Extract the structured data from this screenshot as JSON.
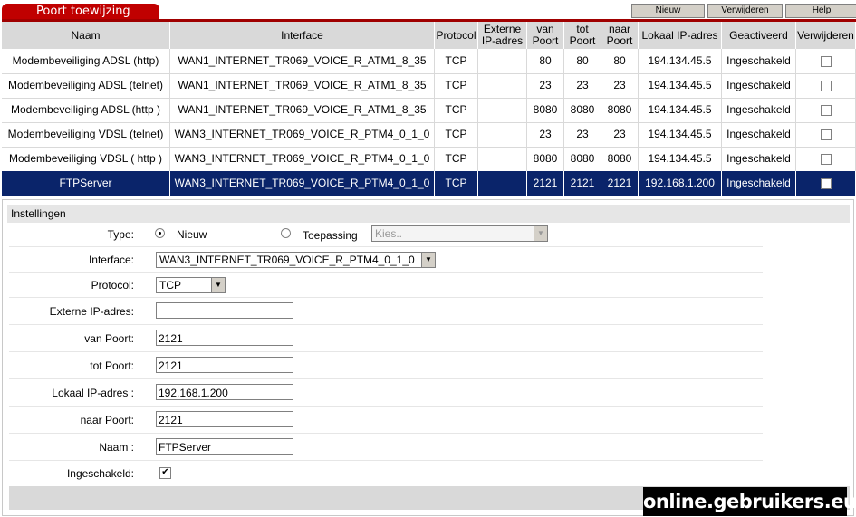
{
  "header": {
    "tab_title": "Poort toewijzing",
    "buttons": [
      "Nieuw",
      "Verwijderen",
      "Help"
    ]
  },
  "table": {
    "columns": [
      "Naam",
      "Interface",
      "Protocol",
      "Externe IP-adres",
      "van Poort",
      "tot Poort",
      "naar Poort",
      "Lokaal IP-adres",
      "Geactiveerd",
      "Verwijderen"
    ],
    "rows": [
      [
        "Modembeveiliging ADSL (http)",
        "WAN1_INTERNET_TR069_VOICE_R_ATM1_8_35",
        "TCP",
        "",
        "80",
        "80",
        "80",
        "194.134.45.5",
        "Ingeschakeld",
        ""
      ],
      [
        "Modembeveiliging ADSL (telnet)",
        "WAN1_INTERNET_TR069_VOICE_R_ATM1_8_35",
        "TCP",
        "",
        "23",
        "23",
        "23",
        "194.134.45.5",
        "Ingeschakeld",
        ""
      ],
      [
        "Modembeveiliging ADSL (http )",
        "WAN1_INTERNET_TR069_VOICE_R_ATM1_8_35",
        "TCP",
        "",
        "8080",
        "8080",
        "8080",
        "194.134.45.5",
        "Ingeschakeld",
        ""
      ],
      [
        "Modembeveiliging VDSL (telnet)",
        "WAN3_INTERNET_TR069_VOICE_R_PTM4_0_1_0",
        "TCP",
        "",
        "23",
        "23",
        "23",
        "194.134.45.5",
        "Ingeschakeld",
        ""
      ],
      [
        "Modembeveiliging VDSL ( http )",
        "WAN3_INTERNET_TR069_VOICE_R_PTM4_0_1_0",
        "TCP",
        "",
        "8080",
        "8080",
        "8080",
        "194.134.45.5",
        "Ingeschakeld",
        ""
      ],
      [
        "FTPServer",
        "WAN3_INTERNET_TR069_VOICE_R_PTM4_0_1_0",
        "TCP",
        "",
        "2121",
        "2121",
        "2121",
        "192.168.1.200",
        "Ingeschakeld",
        ""
      ]
    ],
    "selected_row": 5
  },
  "settings": {
    "title": "Instellingen",
    "type_label": "Type:",
    "type_new": "Nieuw",
    "type_app": "Toepassing",
    "app_placeholder": "Kies..",
    "interface_label": "Interface:",
    "interface_value": "WAN3_INTERNET_TR069_VOICE_R_PTM4_0_1_0",
    "protocol_label": "Protocol:",
    "protocol_value": "TCP",
    "ext_ip_label": "Externe IP-adres:",
    "ext_ip_value": "",
    "from_port_label": "van Poort:",
    "from_port_value": "2121",
    "to_port_label": "tot Poort:",
    "to_port_value": "2121",
    "local_ip_label": "Lokaal IP-adres :",
    "local_ip_value": "192.168.1.200",
    "dest_port_label": "naar Poort:",
    "dest_port_value": "2121",
    "name_label": "Naam :",
    "name_value": "FTPServer",
    "enabled_label": "Ingeschakeld:"
  },
  "watermark": "online.gebruikers.eu"
}
